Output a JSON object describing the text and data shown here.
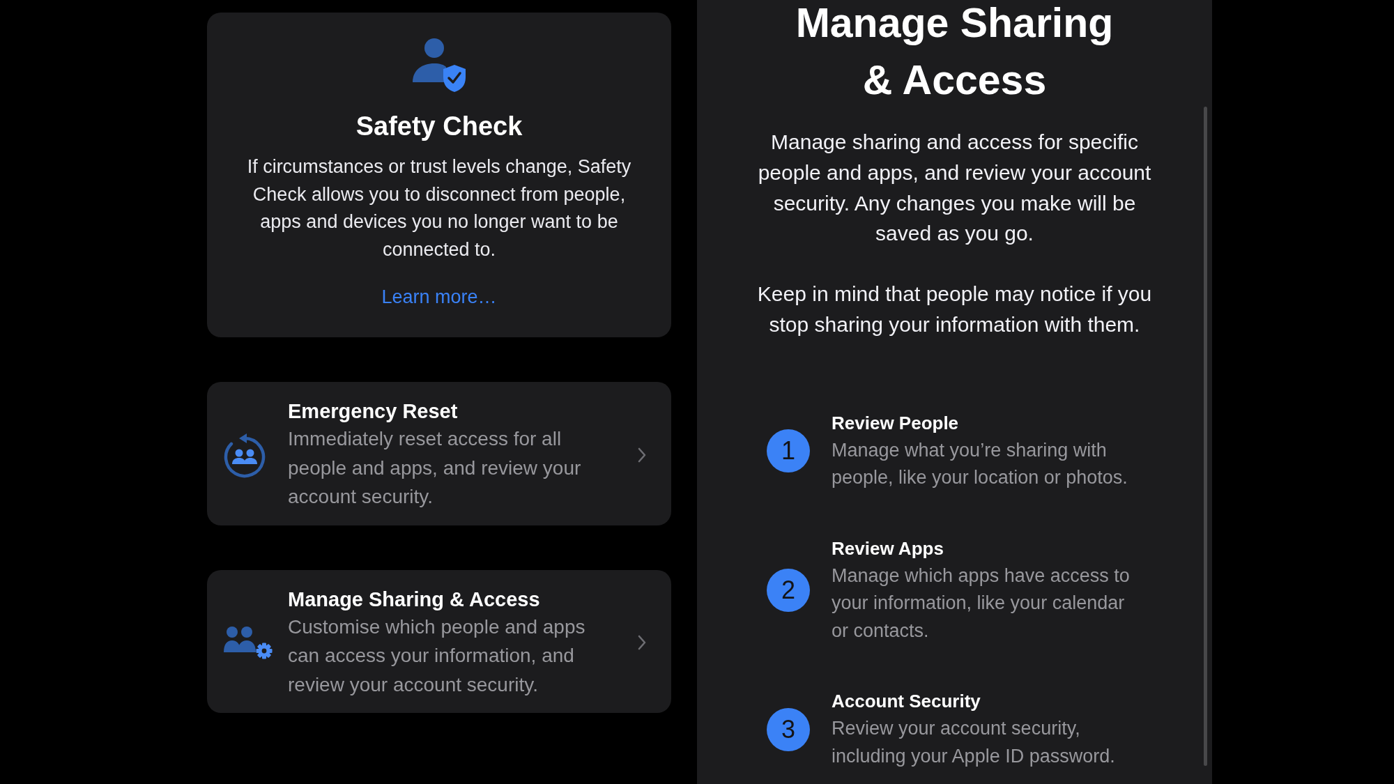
{
  "safety_check": {
    "title": "Safety Check",
    "description": "If circumstances or trust levels change, Safety Check allows you to disconnect from people, apps and devices you no longer want to be connected to.",
    "link": "Learn more…"
  },
  "options": [
    {
      "kind": "reset",
      "title": "Emergency Reset",
      "description": "Immediately reset access for all people and apps, and review your account security."
    },
    {
      "kind": "sharing",
      "title": "Manage Sharing & Access",
      "description": "Customise which people and apps can access your information, and review your account security."
    }
  ],
  "detail": {
    "title": "Manage Sharing & Access",
    "paragraphs": [
      "Manage sharing and access for specific people and apps, and review your account security. Any changes you make will be saved as you go.",
      "Keep in mind that people may notice if you stop sharing your information with them."
    ],
    "steps": [
      {
        "number": "1",
        "title": "Review People",
        "description": "Manage what you’re sharing with people, like your location or photos."
      },
      {
        "number": "2",
        "title": "Review Apps",
        "description": "Manage which apps have access to your information, like your calendar or contacts."
      },
      {
        "number": "3",
        "title": "Account Security",
        "description": "Review your account security, including your Apple ID password."
      }
    ]
  }
}
